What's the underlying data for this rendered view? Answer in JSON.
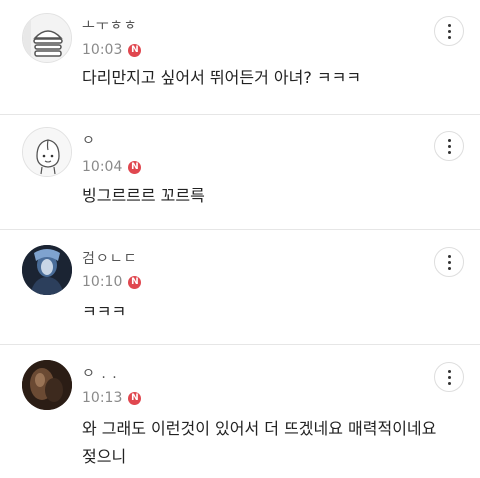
{
  "comments": [
    {
      "author": "ㅗㅜㅎㅎ",
      "time": "10:03",
      "badge": "N",
      "text": "다리만지고 싶어서 뛰어든거 아녀? ㅋㅋㅋ",
      "more_icon": "vertical-ellipsis-icon"
    },
    {
      "author": "ㅇ",
      "time": "10:04",
      "badge": "N",
      "text": "빙그르르르 꼬르륵",
      "more_icon": "vertical-ellipsis-icon"
    },
    {
      "author": "검ㅇㄴㄷ",
      "time": "10:10",
      "badge": "N",
      "text": "ㅋㅋㅋ",
      "more_icon": "vertical-ellipsis-icon"
    },
    {
      "author": "ㅇ . .",
      "time": "10:13",
      "badge": "N",
      "text": "와 그래도 이런것이 있어서 더 뜨겠네요 매력적이네요\n젖으니",
      "more_icon": "vertical-ellipsis-icon"
    }
  ],
  "colors": {
    "badge": "#e0474f",
    "time": "#8a8a8a",
    "divider": "#e6e6e6",
    "text": "#222222"
  }
}
